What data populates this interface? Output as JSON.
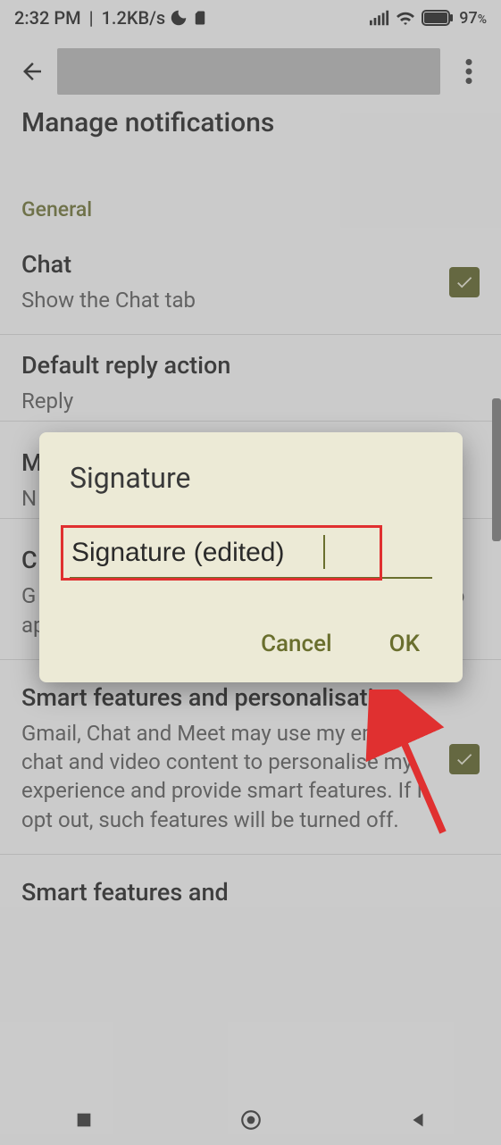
{
  "status": {
    "time": "2:32 PM",
    "net_speed": "1.2KB/s",
    "battery_pct": "97",
    "battery_pct_suffix": "%"
  },
  "header": {
    "cut_off_item": "Manage notifications"
  },
  "sections": {
    "general": "General"
  },
  "settings": {
    "chat": {
      "title": "Chat",
      "sub": "Show the Chat tab"
    },
    "default_reply": {
      "title": "Default reply action",
      "sub": "Reply"
    },
    "mobile_sig": {
      "title_frag": "M",
      "sub_frag": "N"
    },
    "conv_view": {
      "title_frag": "C",
      "sub": "G                                   together. This setting may take some time to apply."
    },
    "smart_features": {
      "title": "Smart features and personalisation",
      "sub": "Gmail, Chat and Meet may use my email, chat and video content to personalise my experience and provide smart features. If I opt out, such features will be turned off."
    },
    "smart_features2": {
      "title_frag": "Smart features and"
    }
  },
  "dialog": {
    "title": "Signature",
    "input_value": "Signature (edited)",
    "cancel": "Cancel",
    "ok": "OK"
  },
  "colors": {
    "accent": "#6a6f2e",
    "dialog_bg": "#ecead6",
    "highlight": "#e03030"
  }
}
